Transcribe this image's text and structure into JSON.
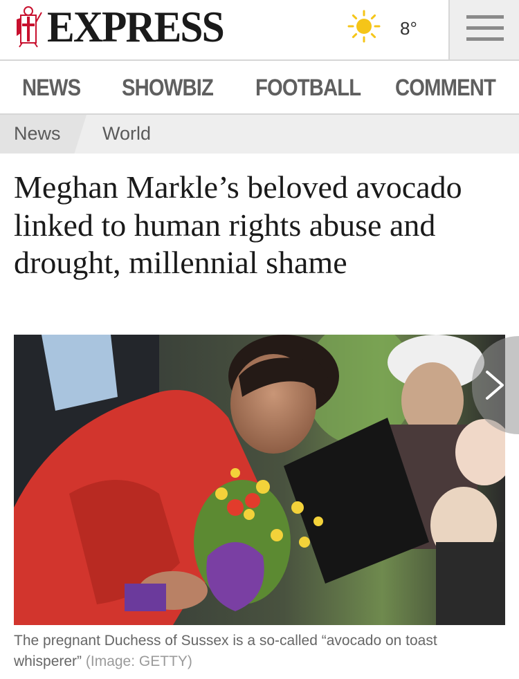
{
  "header": {
    "logo_text": "EXPRESS",
    "weather_icon": "sun-icon",
    "temperature": "8°",
    "menu_icon": "hamburger-menu-icon"
  },
  "nav": {
    "items": [
      {
        "label": "NEWS"
      },
      {
        "label": "SHOWBIZ"
      },
      {
        "label": "FOOTBALL"
      },
      {
        "label": "COMMENT"
      }
    ]
  },
  "breadcrumb": {
    "items": [
      {
        "label": "News"
      },
      {
        "label": "World"
      }
    ]
  },
  "article": {
    "headline": "Meghan Markle’s beloved avocado linked to human rights abuse and drought, millennial shame",
    "caption": "The pregnant Duchess of Sussex is a so-called “avocado on toast whisperer”",
    "credit": "(Image: GETTY)",
    "gallery_next_icon": "chevron-right-icon"
  },
  "colors": {
    "nav_text": "#5f5f5f",
    "logo_red": "#c8102e",
    "sun_yellow": "#f5c518",
    "breadcrumb_bg": "#eeeeee"
  }
}
